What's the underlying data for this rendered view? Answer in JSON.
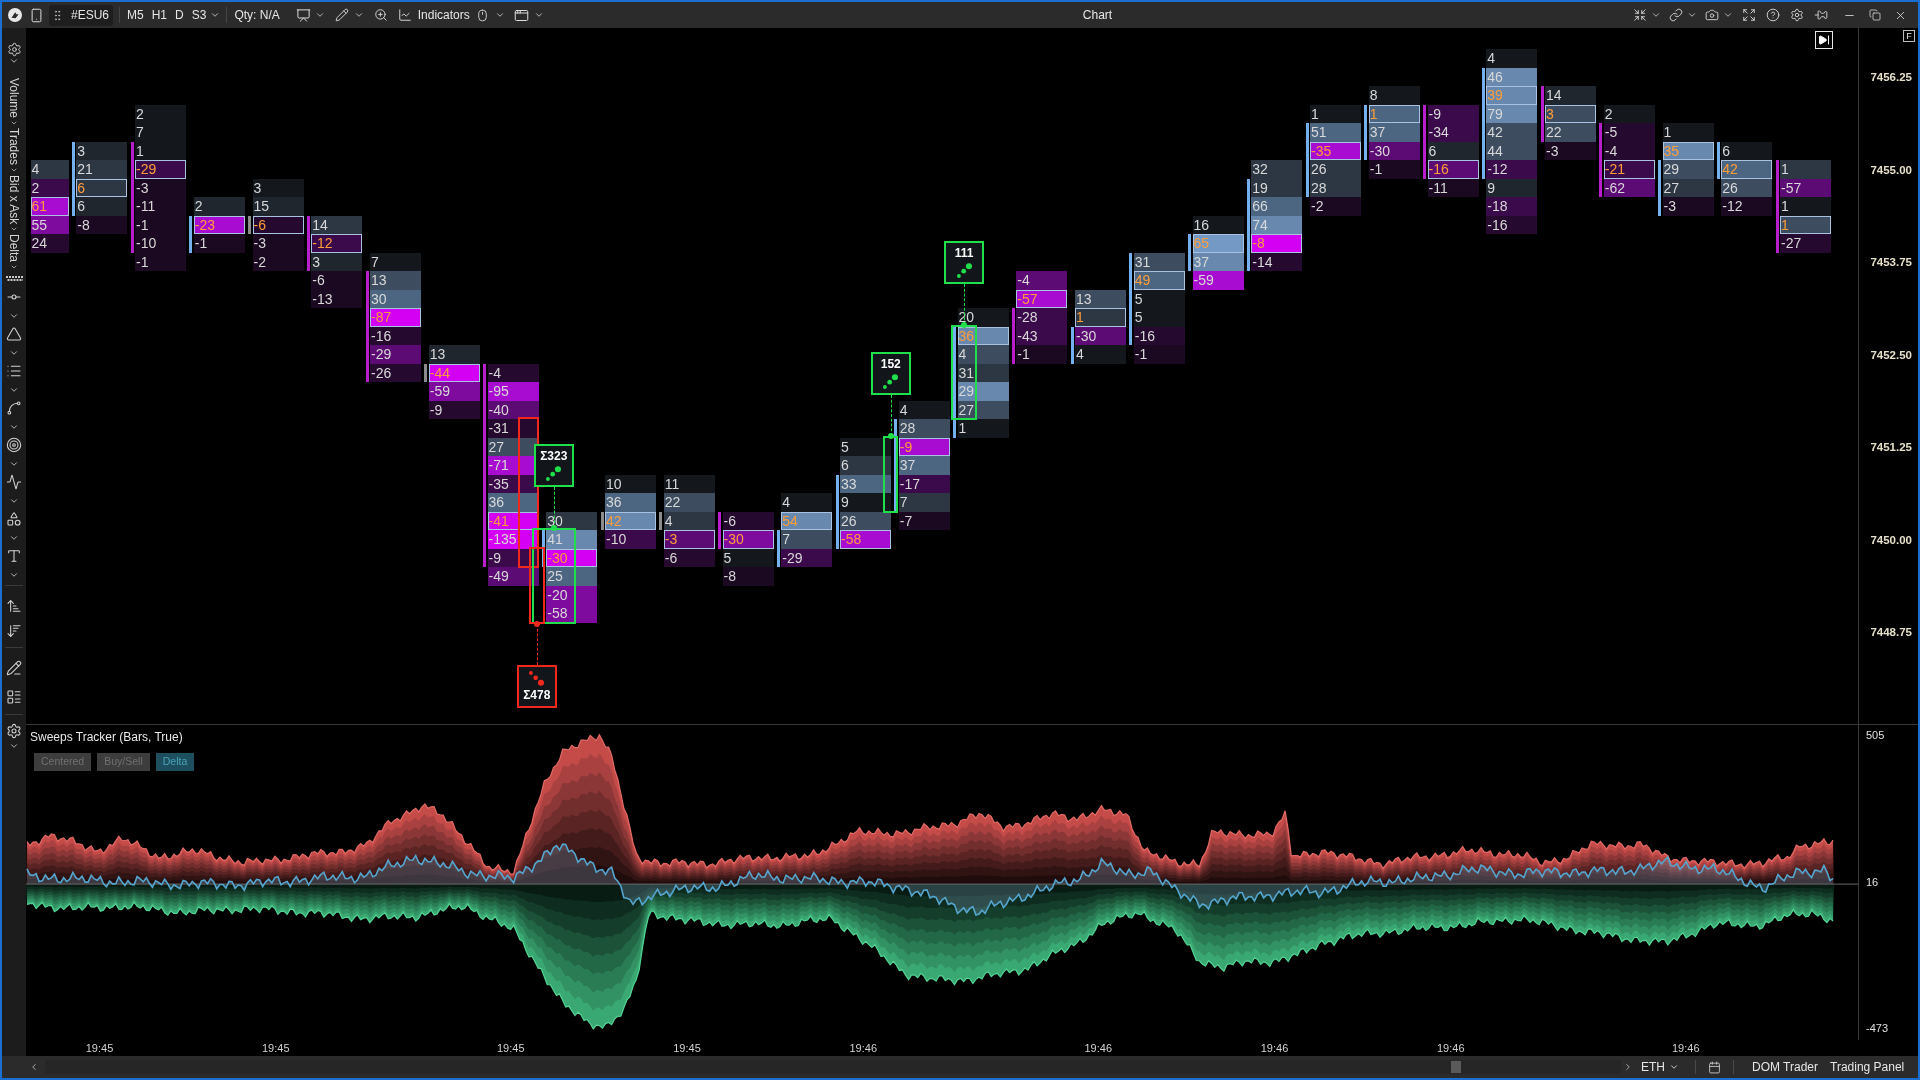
{
  "toolbar": {
    "symbol": "#ESU6",
    "timeframes": [
      "M5",
      "H1",
      "D",
      "S3"
    ],
    "quantity": "Qty: N/A",
    "indicators": "Indicators"
  },
  "window": {
    "title": "Chart"
  },
  "sidebar": {
    "breadcrumb": [
      "Volume",
      "Trades",
      "Bid x Ask",
      "Delta"
    ]
  },
  "price_chart": {
    "axis_button": "F",
    "price_axis": [
      "7456.25",
      "7455.00",
      "7453.75",
      "7452.50",
      "7451.25",
      "7450.00",
      "7448.75"
    ],
    "bars": [
      {
        "cells": [
          {
            "text": "4",
            "color": "#2c3743",
            "poc": false,
            "body": false
          },
          {
            "text": "2",
            "color": "#3a0a4a",
            "poc": false,
            "body": false
          },
          {
            "text": "61",
            "color": "#a80cd0",
            "poc": true,
            "body": false
          },
          {
            "text": "55",
            "color": "#7e0a9e",
            "poc": false,
            "body": false
          },
          {
            "text": "24",
            "color": "#25092e",
            "poc": false,
            "body": false
          }
        ]
      },
      {
        "kind": "up",
        "time": "19:45",
        "cells": [
          {
            "text": "3",
            "color": "#1f262e",
            "poc": false,
            "body": true
          },
          {
            "text": "21",
            "color": "#2c3743",
            "poc": false,
            "body": true
          },
          {
            "text": "6",
            "color": "#2c3743",
            "poc": true,
            "body": true
          },
          {
            "text": "6",
            "color": "#1f262e",
            "poc": false,
            "body": true
          },
          {
            "text": "-8",
            "color": "#1a0920",
            "poc": false,
            "body": false
          }
        ]
      },
      {
        "kind": "down",
        "cells": [
          {
            "text": "2",
            "color": "#14181d",
            "poc": false,
            "body": false
          },
          {
            "text": "7",
            "color": "#14181d",
            "poc": false,
            "body": false
          },
          {
            "text": "1",
            "color": "#14181d",
            "poc": false,
            "body": true
          },
          {
            "text": "-29",
            "color": "#3a0a4a",
            "poc": true,
            "body": true
          },
          {
            "text": "-3",
            "color": "#1a0920",
            "poc": false,
            "body": true
          },
          {
            "text": "-11",
            "color": "#1a0920",
            "poc": false,
            "body": true
          },
          {
            "text": "-1",
            "color": "#1a0920",
            "poc": false,
            "body": true
          },
          {
            "text": "-10",
            "color": "#1a0920",
            "poc": false,
            "body": true
          },
          {
            "text": "-1",
            "color": "#1a0920",
            "poc": false,
            "body": false
          }
        ]
      },
      {
        "kind": "up",
        "cells": [
          {
            "text": "2",
            "color": "#1f262e",
            "poc": false,
            "body": false
          },
          {
            "text": "-23",
            "color": "#a80cd0",
            "poc": true,
            "body": true
          },
          {
            "text": "-1",
            "color": "#1a0920",
            "poc": false,
            "body": true
          }
        ]
      },
      {
        "kind": "flat",
        "time": "19:45",
        "cells": [
          {
            "text": "3",
            "color": "#14181d",
            "poc": false,
            "body": false
          },
          {
            "text": "15",
            "color": "#1f262e",
            "poc": false,
            "body": false
          },
          {
            "text": "-6",
            "color": "#25092e",
            "poc": true,
            "body": true
          },
          {
            "text": "-3",
            "color": "#1a0920",
            "poc": false,
            "body": false
          },
          {
            "text": "-2",
            "color": "#1a0920",
            "poc": false,
            "body": false
          }
        ]
      },
      {
        "kind": "down",
        "cells": [
          {
            "text": "14",
            "color": "#2c3743",
            "poc": false,
            "body": true
          },
          {
            "text": "-12",
            "color": "#3a0a4a",
            "poc": true,
            "body": true
          },
          {
            "text": "3",
            "color": "#1f262e",
            "poc": false,
            "body": true
          },
          {
            "text": "-6",
            "color": "#1a0920",
            "poc": false,
            "body": false
          },
          {
            "text": "-13",
            "color": "#1a0920",
            "poc": false,
            "body": false
          }
        ]
      },
      {
        "kind": "down",
        "cells": [
          {
            "text": "7",
            "color": "#14181d",
            "poc": false,
            "body": false
          },
          {
            "text": "13",
            "color": "#3d4d5f",
            "poc": false,
            "body": true
          },
          {
            "text": "30",
            "color": "#4c6580",
            "poc": false,
            "body": true
          },
          {
            "text": "-87",
            "color": "#d400f4",
            "poc": true,
            "body": true
          },
          {
            "text": "-16",
            "color": "#25092e",
            "poc": false,
            "body": true
          },
          {
            "text": "-29",
            "color": "#5c0a74",
            "poc": false,
            "body": true
          },
          {
            "text": "-26",
            "color": "#25092e",
            "poc": false,
            "body": true
          }
        ]
      },
      {
        "kind": "flat",
        "cells": [
          {
            "text": "13",
            "color": "#1f262e",
            "poc": false,
            "body": false
          },
          {
            "text": "-44",
            "color": "#d400f4",
            "poc": true,
            "body": true
          },
          {
            "text": "-59",
            "color": "#7e0a9e",
            "poc": false,
            "body": false
          },
          {
            "text": "-9",
            "color": "#25092e",
            "poc": false,
            "body": false
          }
        ]
      },
      {
        "kind": "down",
        "time": "19:45",
        "cells": [
          {
            "text": "-4",
            "color": "#25092e",
            "poc": false,
            "body": true
          },
          {
            "text": "-95",
            "color": "#a80cd0",
            "poc": false,
            "body": true
          },
          {
            "text": "-40",
            "color": "#5c0a74",
            "poc": false,
            "body": true
          },
          {
            "text": "-31",
            "color": "#25092e",
            "poc": false,
            "body": true
          },
          {
            "text": "27",
            "color": "#3d4d5f",
            "poc": false,
            "body": true
          },
          {
            "text": "-71",
            "color": "#a80cd0",
            "poc": false,
            "body": true
          },
          {
            "text": "-35",
            "color": "#3a0a4a",
            "poc": false,
            "body": true
          },
          {
            "text": "36",
            "color": "#4c6580",
            "poc": false,
            "body": true
          },
          {
            "text": "-41",
            "color": "#d400f4",
            "poc": true,
            "body": true
          },
          {
            "text": "-135",
            "color": "#d400f4",
            "poc": false,
            "body": true
          },
          {
            "text": "-9",
            "color": "#3a0a4a",
            "poc": false,
            "body": true
          },
          {
            "text": "-49",
            "color": "#5c0a74",
            "poc": false,
            "body": false
          }
        ],
        "sweeps": [
          {
            "kind": "sell"
          }
        ]
      },
      {
        "kind": "up",
        "cells": [
          {
            "text": "30",
            "color": "#2c3743",
            "poc": false,
            "body": false
          },
          {
            "text": "41",
            "color": "#6889ad",
            "poc": false,
            "body": true
          },
          {
            "text": "-30",
            "color": "#d400f4",
            "poc": true,
            "body": true
          },
          {
            "text": "25",
            "color": "#4c6580",
            "poc": false,
            "body": false
          },
          {
            "text": "-20",
            "color": "#7e0a9e",
            "poc": false,
            "body": false
          },
          {
            "text": "-58",
            "color": "#7e0a9e",
            "poc": false,
            "body": false
          }
        ],
        "sweeps": [
          {
            "label": "Σ323",
            "kind": "buy"
          },
          {
            "label": "Σ478",
            "kind": "sell"
          }
        ]
      },
      {
        "kind": "flat",
        "cells": [
          {
            "text": "10",
            "color": "#14181d",
            "poc": false,
            "body": false
          },
          {
            "text": "36",
            "color": "#4c6580",
            "poc": false,
            "body": false
          },
          {
            "text": "42",
            "color": "#6889ad",
            "poc": true,
            "body": true
          },
          {
            "text": "-10",
            "color": "#3a0a4a",
            "poc": false,
            "body": false
          }
        ]
      },
      {
        "kind": "flat",
        "time": "19:45",
        "cells": [
          {
            "text": "11",
            "color": "#14181d",
            "poc": false,
            "body": false
          },
          {
            "text": "22",
            "color": "#3d4d5f",
            "poc": false,
            "body": false
          },
          {
            "text": "4",
            "color": "#2c3743",
            "poc": false,
            "body": true
          },
          {
            "text": "-3",
            "color": "#5c0a74",
            "poc": true,
            "body": false
          },
          {
            "text": "-6",
            "color": "#25092e",
            "poc": false,
            "body": false
          }
        ]
      },
      {
        "kind": "down",
        "cells": [
          {
            "text": "-6",
            "color": "#25092e",
            "poc": false,
            "body": true
          },
          {
            "text": "-30",
            "color": "#7e0a9e",
            "poc": true,
            "body": true
          },
          {
            "text": "5",
            "color": "#14181d",
            "poc": false,
            "body": false
          },
          {
            "text": "-8",
            "color": "#1a0920",
            "poc": false,
            "body": false
          }
        ]
      },
      {
        "kind": "up",
        "cells": [
          {
            "text": "4",
            "color": "#14181d",
            "poc": false,
            "body": false
          },
          {
            "text": "54",
            "color": "#6889ad",
            "poc": true,
            "body": false
          },
          {
            "text": "7",
            "color": "#3d4d5f",
            "poc": false,
            "body": true
          },
          {
            "text": "-29",
            "color": "#3a0a4a",
            "poc": false,
            "body": true
          }
        ]
      },
      {
        "kind": "up",
        "time": "19:46",
        "cells": [
          {
            "text": "5",
            "color": "#14181d",
            "poc": false,
            "body": false
          },
          {
            "text": "6",
            "color": "#2c3743",
            "poc": false,
            "body": false
          },
          {
            "text": "33",
            "color": "#4c6580",
            "poc": false,
            "body": true
          },
          {
            "text": "9",
            "color": "#14181d",
            "poc": false,
            "body": true
          },
          {
            "text": "26",
            "color": "#3d4d5f",
            "poc": false,
            "body": true
          },
          {
            "text": "-58",
            "color": "#a80cd0",
            "poc": true,
            "body": true
          }
        ]
      },
      {
        "kind": "up",
        "cells": [
          {
            "text": "4",
            "color": "#14181d",
            "poc": false,
            "body": false
          },
          {
            "text": "28",
            "color": "#3d4d5f",
            "poc": false,
            "body": true
          },
          {
            "text": "-9",
            "color": "#a80cd0",
            "poc": true,
            "body": true
          },
          {
            "text": "37",
            "color": "#4c6580",
            "poc": false,
            "body": true
          },
          {
            "text": "-17",
            "color": "#3a0a4a",
            "poc": false,
            "body": true
          },
          {
            "text": "7",
            "color": "#2c3743",
            "poc": false,
            "body": true
          },
          {
            "text": "-7",
            "color": "#1a0920",
            "poc": false,
            "body": false
          }
        ],
        "sweeps": [
          {
            "label": "152",
            "kind": "buy"
          }
        ]
      },
      {
        "kind": "up",
        "cells": [
          {
            "text": "20",
            "color": "#14181d",
            "poc": false,
            "body": false
          },
          {
            "text": "36",
            "color": "#6889ad",
            "poc": true,
            "body": true
          },
          {
            "text": "4",
            "color": "#3d4d5f",
            "poc": false,
            "body": true
          },
          {
            "text": "31",
            "color": "#2c3743",
            "poc": false,
            "body": true
          },
          {
            "text": "29",
            "color": "#6889ad",
            "poc": false,
            "body": true
          },
          {
            "text": "27",
            "color": "#3d4d5f",
            "poc": false,
            "body": true
          },
          {
            "text": "1",
            "color": "#14181d",
            "poc": false,
            "body": true
          }
        ],
        "sweeps": [
          {
            "label": "111",
            "kind": "buy"
          }
        ]
      },
      {
        "kind": "down",
        "cells": [
          {
            "text": "-4",
            "color": "#5c0a74",
            "poc": false,
            "body": false
          },
          {
            "text": "-57",
            "color": "#a80cd0",
            "poc": true,
            "body": false
          },
          {
            "text": "-28",
            "color": "#3a0a4a",
            "poc": false,
            "body": true
          },
          {
            "text": "-43",
            "color": "#3a0a4a",
            "poc": false,
            "body": true
          },
          {
            "text": "-1",
            "color": "#1a0920",
            "poc": false,
            "body": true
          }
        ]
      },
      {
        "kind": "up",
        "time": "19:46",
        "cells": [
          {
            "text": "13",
            "color": "#3d4d5f",
            "poc": false,
            "body": false
          },
          {
            "text": "1",
            "color": "#2c3743",
            "poc": true,
            "body": false
          },
          {
            "text": "-30",
            "color": "#5c0a74",
            "poc": false,
            "body": true
          },
          {
            "text": "4",
            "color": "#14181d",
            "poc": false,
            "body": true
          }
        ]
      },
      {
        "kind": "up",
        "cells": [
          {
            "text": "31",
            "color": "#3d4d5f",
            "poc": false,
            "body": true
          },
          {
            "text": "49",
            "color": "#4c6580",
            "poc": true,
            "body": true
          },
          {
            "text": "5",
            "color": "#14181d",
            "poc": false,
            "body": true
          },
          {
            "text": "5",
            "color": "#14181d",
            "poc": false,
            "body": true
          },
          {
            "text": "-16",
            "color": "#25092e",
            "poc": false,
            "body": true
          },
          {
            "text": "-1",
            "color": "#1a0920",
            "poc": false,
            "body": false
          }
        ]
      },
      {
        "kind": "up",
        "cells": [
          {
            "text": "16",
            "color": "#14181d",
            "poc": false,
            "body": false
          },
          {
            "text": "65",
            "color": "#7399c4",
            "poc": true,
            "body": true
          },
          {
            "text": "37",
            "color": "#6889ad",
            "poc": false,
            "body": true
          },
          {
            "text": "-59",
            "color": "#a80cd0",
            "poc": false,
            "body": false
          }
        ]
      },
      {
        "kind": "up",
        "time": "19:46",
        "cells": [
          {
            "text": "32",
            "color": "#2c3743",
            "poc": false,
            "body": false
          },
          {
            "text": "19",
            "color": "#2c3743",
            "poc": false,
            "body": true
          },
          {
            "text": "66",
            "color": "#4c6580",
            "poc": false,
            "body": true
          },
          {
            "text": "74",
            "color": "#6889ad",
            "poc": false,
            "body": true
          },
          {
            "text": "-8",
            "color": "#d400f4",
            "poc": true,
            "body": true
          },
          {
            "text": "-14",
            "color": "#25092e",
            "poc": false,
            "body": true
          }
        ]
      },
      {
        "kind": "up",
        "cells": [
          {
            "text": "1",
            "color": "#14181d",
            "poc": false,
            "body": false
          },
          {
            "text": "51",
            "color": "#4c6580",
            "poc": false,
            "body": true
          },
          {
            "text": "-35",
            "color": "#a80cd0",
            "poc": true,
            "body": true
          },
          {
            "text": "26",
            "color": "#2c3743",
            "poc": false,
            "body": true
          },
          {
            "text": "28",
            "color": "#2c3743",
            "poc": false,
            "body": true
          },
          {
            "text": "-2",
            "color": "#1a0920",
            "poc": false,
            "body": false
          }
        ]
      },
      {
        "kind": "up",
        "cells": [
          {
            "text": "8",
            "color": "#14181d",
            "poc": false,
            "body": false
          },
          {
            "text": "1",
            "color": "#4c6580",
            "poc": true,
            "body": true
          },
          {
            "text": "37",
            "color": "#4c6580",
            "poc": false,
            "body": true
          },
          {
            "text": "-30",
            "color": "#5c0a74",
            "poc": false,
            "body": true
          },
          {
            "text": "-1",
            "color": "#1a0920",
            "poc": false,
            "body": false
          }
        ]
      },
      {
        "kind": "down",
        "time": "19:46",
        "cells": [
          {
            "text": "-9",
            "color": "#3a0a4a",
            "poc": false,
            "body": true
          },
          {
            "text": "-34",
            "color": "#3a0a4a",
            "poc": false,
            "body": true
          },
          {
            "text": "6",
            "color": "#1f262e",
            "poc": false,
            "body": true
          },
          {
            "text": "-16",
            "color": "#5c0a74",
            "poc": true,
            "body": true
          },
          {
            "text": "-11",
            "color": "#1a0920",
            "poc": false,
            "body": false
          }
        ]
      },
      {
        "kind": "up",
        "cells": [
          {
            "text": "4",
            "color": "#14181d",
            "poc": false,
            "body": false
          },
          {
            "text": "46",
            "color": "#6889ad",
            "poc": false,
            "body": true
          },
          {
            "text": "39",
            "color": "#6889ad",
            "poc": true,
            "body": true
          },
          {
            "text": "79",
            "color": "#6889ad",
            "poc": false,
            "body": true
          },
          {
            "text": "42",
            "color": "#3d4d5f",
            "poc": false,
            "body": true
          },
          {
            "text": "44",
            "color": "#3d4d5f",
            "poc": false,
            "body": true
          },
          {
            "text": "-12",
            "color": "#3a0a4a",
            "poc": false,
            "body": true
          },
          {
            "text": "9",
            "color": "#1f262e",
            "poc": false,
            "body": false
          },
          {
            "text": "-18",
            "color": "#3a0a4a",
            "poc": false,
            "body": false
          },
          {
            "text": "-16",
            "color": "#25092e",
            "poc": false,
            "body": false
          }
        ]
      },
      {
        "kind": "down",
        "cells": [
          {
            "text": "14",
            "color": "#1f262e",
            "poc": false,
            "body": true
          },
          {
            "text": "3",
            "color": "#3d4d5f",
            "poc": true,
            "body": true
          },
          {
            "text": "22",
            "color": "#3d4d5f",
            "poc": false,
            "body": true
          },
          {
            "text": "-3",
            "color": "#1a0920",
            "poc": false,
            "body": false
          }
        ]
      },
      {
        "kind": "down",
        "cells": [
          {
            "text": "2",
            "color": "#14181d",
            "poc": false,
            "body": false
          },
          {
            "text": "-5",
            "color": "#25092e",
            "poc": false,
            "body": true
          },
          {
            "text": "-4",
            "color": "#25092e",
            "poc": false,
            "body": true
          },
          {
            "text": "-21",
            "color": "#3a0a4a",
            "poc": true,
            "body": true
          },
          {
            "text": "-62",
            "color": "#5c0a74",
            "poc": false,
            "body": true
          }
        ]
      },
      {
        "kind": "up",
        "time": "19:46",
        "cells": [
          {
            "text": "1",
            "color": "#14181d",
            "poc": false,
            "body": false
          },
          {
            "text": "35",
            "color": "#6889ad",
            "poc": true,
            "body": false
          },
          {
            "text": "29",
            "color": "#3d4d5f",
            "poc": false,
            "body": true
          },
          {
            "text": "27",
            "color": "#2c3743",
            "poc": false,
            "body": true
          },
          {
            "text": "-3",
            "color": "#1a0920",
            "poc": false,
            "body": true
          }
        ]
      },
      {
        "kind": "up",
        "cells": [
          {
            "text": "6",
            "color": "#14181d",
            "poc": false,
            "body": true
          },
          {
            "text": "42",
            "color": "#4c6580",
            "poc": true,
            "body": true
          },
          {
            "text": "26",
            "color": "#3d4d5f",
            "poc": false,
            "body": false
          },
          {
            "text": "-12",
            "color": "#1a0920",
            "poc": false,
            "body": false
          }
        ]
      },
      {
        "kind": "down",
        "cells": [
          {
            "text": "1",
            "color": "#2c3743",
            "poc": false,
            "body": true
          },
          {
            "text": "-57",
            "color": "#5c0a74",
            "poc": false,
            "body": true
          },
          {
            "text": "1",
            "color": "#14181d",
            "poc": false,
            "body": true
          },
          {
            "text": "1",
            "color": "#3d4d5f",
            "poc": true,
            "body": true
          },
          {
            "text": "-27",
            "color": "#25092e",
            "poc": false,
            "body": true
          }
        ]
      }
    ]
  },
  "indicator": {
    "title": "Sweeps Tracker (Bars, True)",
    "toggles": [
      {
        "label": "Centered",
        "selected": false
      },
      {
        "label": "Buy/Sell",
        "selected": false
      },
      {
        "label": "Delta",
        "selected": true
      }
    ],
    "axis": [
      "505",
      "16",
      "-473"
    ]
  },
  "status_bar": {
    "session": "ETH",
    "buttons": [
      "DOM Trader",
      "Trading Panel"
    ]
  }
}
